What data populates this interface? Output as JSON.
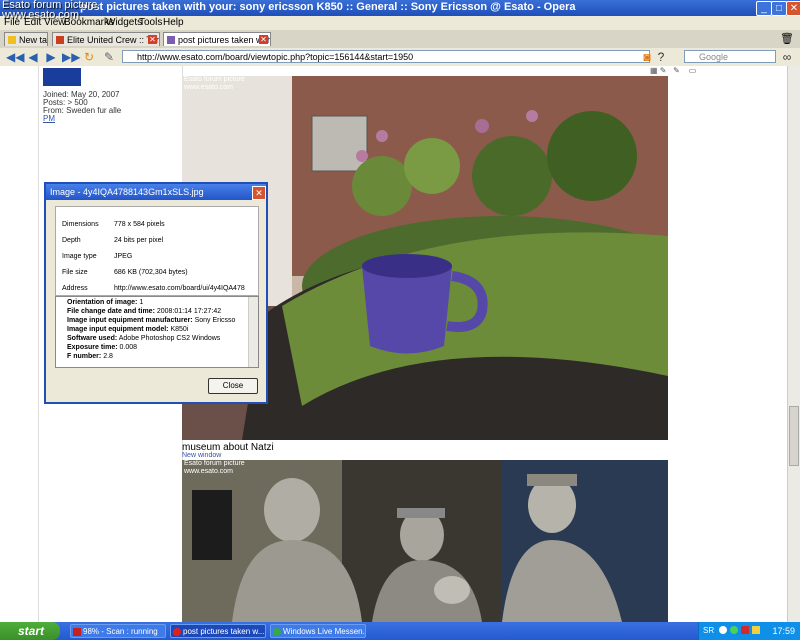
{
  "window": {
    "title": "post pictures taken with your: sony ericsson K850 :: General :: Sony Ericsson @ Esato - Opera",
    "watermark_line1": "Esato forum picture",
    "watermark_line2": "www.esato.com"
  },
  "menu": {
    "file": "File",
    "edit": "Edit",
    "view": "View",
    "bookmarks": "Bookmarks",
    "widgets": "Widgets",
    "tools": "Tools",
    "help": "Help"
  },
  "tabs": [
    {
      "label": "New tab"
    },
    {
      "label": "Elite United Crew :: Torr..."
    },
    {
      "label": "post pictures taken with ..."
    }
  ],
  "address": {
    "url": "http://www.esato.com/board/viewtopic.php?topic=156144&start=1950",
    "search_placeholder": "Google"
  },
  "profile": {
    "joined": "Joined: May 20, 2007",
    "posts": "Posts: > 500",
    "from": "From: Sweden fur alle",
    "pm": "PM"
  },
  "post": {
    "watermark1": "Esato forum picture",
    "watermark2": "www.esato.com",
    "caption": "museum about Natzi",
    "new_window": "New window"
  },
  "dialog": {
    "title": "Image - 4y4IQA4788143Gm1xSLS.jpg",
    "props": [
      {
        "label": "Dimensions",
        "value": "778 x 584 pixels"
      },
      {
        "label": "Depth",
        "value": "24 bits per pixel"
      },
      {
        "label": "Image type",
        "value": "JPEG"
      },
      {
        "label": "File size",
        "value": "686 KB (702,304 bytes)"
      },
      {
        "label": "Address",
        "value": "http://www.esato.com/board/ui/4y4IQA478"
      }
    ],
    "exif": [
      {
        "label": "Orientation of image:",
        "value": "1"
      },
      {
        "label": "File change date and time:",
        "value": "2008:01:14 17:27:42"
      },
      {
        "label": "Image input equipment manufacturer:",
        "value": "Sony Ericsso"
      },
      {
        "label": "Image input equipment model:",
        "value": "K850i"
      },
      {
        "label": "Software used:",
        "value": "Adobe Photoshop CS2 Windows"
      },
      {
        "label": "Exposure time:",
        "value": "0.008"
      },
      {
        "label": "F number:",
        "value": "2.8"
      }
    ],
    "close_label": "Close"
  },
  "taskbar": {
    "start_label": "start",
    "tasks": [
      {
        "label": "98% - Scan : running"
      },
      {
        "label": "post pictures taken w..."
      },
      {
        "label": "Windows Live Messen..."
      }
    ],
    "tray_lang": "SR",
    "clock": "17:59"
  }
}
